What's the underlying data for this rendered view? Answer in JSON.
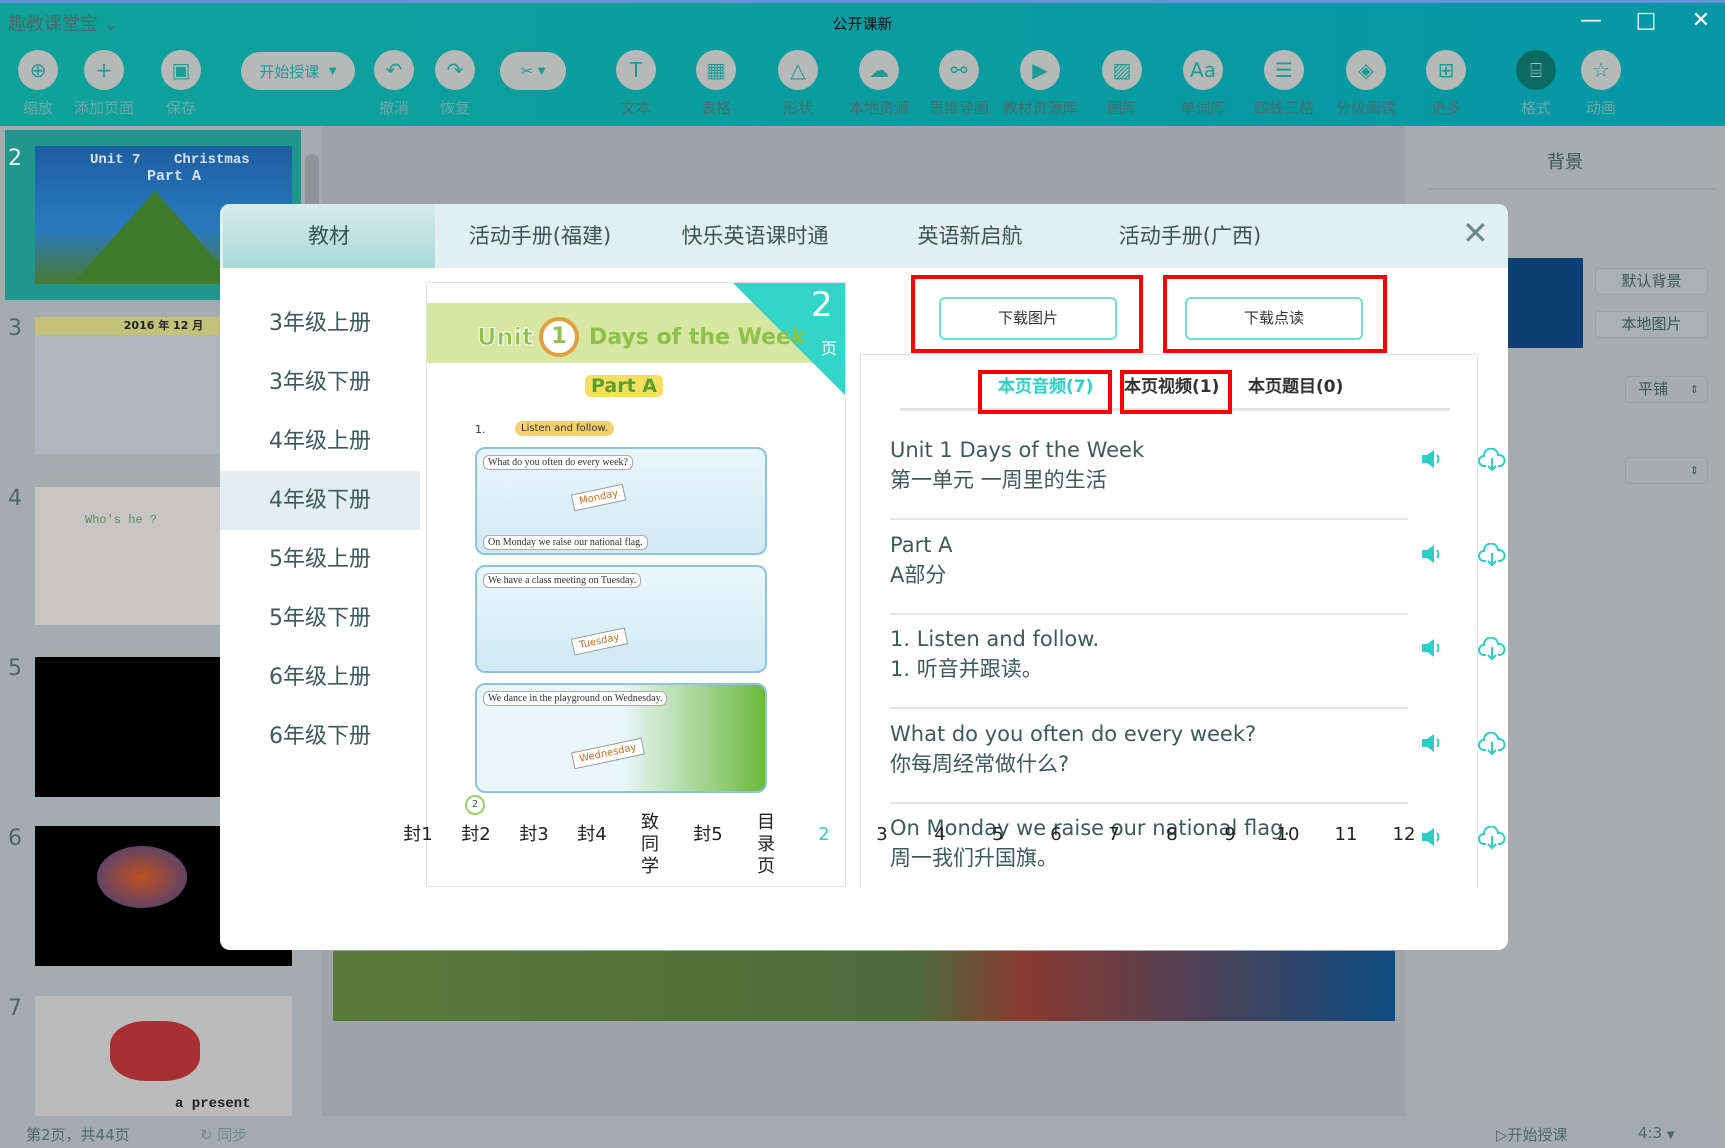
{
  "app": {
    "name": "趣教课堂宝",
    "title": "公开课新"
  },
  "toolbar": [
    {
      "label": "缩放",
      "icon": "zoom-icon"
    },
    {
      "label": "添加页面",
      "icon": "plus-icon"
    },
    {
      "label": "保存",
      "icon": "save-icon"
    },
    {
      "label": "撤消",
      "icon": "undo-icon"
    },
    {
      "label": "恢复",
      "icon": "redo-icon"
    },
    {
      "label": "文本",
      "icon": "text-icon"
    },
    {
      "label": "表格",
      "icon": "table-icon"
    },
    {
      "label": "形状",
      "icon": "shape-icon"
    },
    {
      "label": "本地资源",
      "icon": "upload-cloud-icon"
    },
    {
      "label": "思维导图",
      "icon": "mindmap-icon"
    },
    {
      "label": "教材资源库",
      "icon": "video-icon"
    },
    {
      "label": "图库",
      "icon": "image-icon"
    },
    {
      "label": "单词库",
      "icon": "aa-icon"
    },
    {
      "label": "四线三格",
      "icon": "lines-icon"
    },
    {
      "label": "分级阅读",
      "icon": "layers-icon"
    },
    {
      "label": "更多",
      "icon": "grid-icon"
    },
    {
      "label": "格式",
      "icon": "format-icon"
    },
    {
      "label": "动画",
      "icon": "star-icon"
    }
  ],
  "start_class": "开始授课",
  "slides": [
    {
      "num": "2",
      "title": "Unit 7    Christmas",
      "subtitle": "Part A"
    },
    {
      "num": "3",
      "title": "2016  年  12  月"
    },
    {
      "num": "4",
      "title": "Who's he ?"
    },
    {
      "num": "5"
    },
    {
      "num": "6"
    },
    {
      "num": "7",
      "title": "a present"
    }
  ],
  "right_panel": {
    "title": "背景",
    "default_bg": "默认背景",
    "local_img": "本地图片",
    "fill_mode": "平铺",
    "second_select": ""
  },
  "status": {
    "page_info": "第2页，共44页",
    "sync": "同步",
    "start": "开始授课",
    "ratio": "4:3"
  },
  "dialog": {
    "tabs": [
      "教材",
      "活动手册(福建)",
      "快乐英语课时通",
      "英语新启航",
      "活动手册(广西)"
    ],
    "active_tab": 0,
    "grades": [
      "3年级上册",
      "3年级下册",
      "4年级上册",
      "4年级下册",
      "5年级上册",
      "5年级下册",
      "6年级上册",
      "6年级下册"
    ],
    "selected_grade": 3,
    "book": {
      "page_num": "2",
      "page_suffix": "页",
      "unit": "Unit",
      "unit_no": "1",
      "unit_title": "Days of the Week",
      "part": "Part A",
      "task": "Listen and follow.",
      "task_no": "1.",
      "scenes": [
        {
          "caption": "What do you often do every week?",
          "sub": "On Monday we raise our national flag.",
          "label": "Monday"
        },
        {
          "caption": "We have a class meeting on Tuesday.",
          "label": "Tuesday"
        },
        {
          "caption": "We dance in the playground on Wednesday.",
          "label": "Wednesday"
        }
      ],
      "footer_no": "2"
    },
    "download_image": "下载图片",
    "download_read": "下载点读",
    "sub_tabs": [
      "本页音频(7)",
      "本页视频(1)",
      "本页题目(0)"
    ],
    "active_sub_tab": 0,
    "audio_items": [
      {
        "en": "Unit 1  Days of the Week",
        "zh": "第一单元  一周里的生活"
      },
      {
        "en": "Part A",
        "zh": "A部分"
      },
      {
        "en": "1. Listen and follow.",
        "zh": "1. 听音并跟读。"
      },
      {
        "en": "What do you often do every week?",
        "zh": "你每周经常做什么?"
      },
      {
        "en": "On Monday we raise our national flag.",
        "zh": "周一我们升国旗。"
      }
    ],
    "pages": [
      "封1",
      "封2",
      "封3",
      "封4",
      "致同学",
      "封5",
      "目录页",
      "2",
      "3",
      "4",
      "5",
      "6",
      "7",
      "8",
      "9",
      "10",
      "11",
      "12"
    ],
    "current_page": "2",
    "colors": {
      "accent": "#2ccfc4",
      "highlight": "#ff0000"
    }
  }
}
